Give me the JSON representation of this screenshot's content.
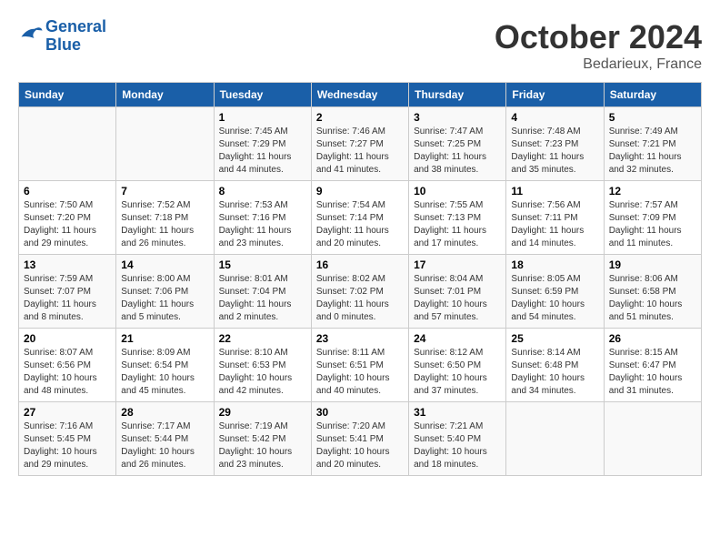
{
  "header": {
    "logo_line1": "General",
    "logo_line2": "Blue",
    "month": "October 2024",
    "location": "Bedarieux, France"
  },
  "days_of_week": [
    "Sunday",
    "Monday",
    "Tuesday",
    "Wednesday",
    "Thursday",
    "Friday",
    "Saturday"
  ],
  "weeks": [
    [
      {
        "day": null
      },
      {
        "day": null
      },
      {
        "day": "1",
        "sunrise": "Sunrise: 7:45 AM",
        "sunset": "Sunset: 7:29 PM",
        "daylight": "Daylight: 11 hours and 44 minutes."
      },
      {
        "day": "2",
        "sunrise": "Sunrise: 7:46 AM",
        "sunset": "Sunset: 7:27 PM",
        "daylight": "Daylight: 11 hours and 41 minutes."
      },
      {
        "day": "3",
        "sunrise": "Sunrise: 7:47 AM",
        "sunset": "Sunset: 7:25 PM",
        "daylight": "Daylight: 11 hours and 38 minutes."
      },
      {
        "day": "4",
        "sunrise": "Sunrise: 7:48 AM",
        "sunset": "Sunset: 7:23 PM",
        "daylight": "Daylight: 11 hours and 35 minutes."
      },
      {
        "day": "5",
        "sunrise": "Sunrise: 7:49 AM",
        "sunset": "Sunset: 7:21 PM",
        "daylight": "Daylight: 11 hours and 32 minutes."
      }
    ],
    [
      {
        "day": "6",
        "sunrise": "Sunrise: 7:50 AM",
        "sunset": "Sunset: 7:20 PM",
        "daylight": "Daylight: 11 hours and 29 minutes."
      },
      {
        "day": "7",
        "sunrise": "Sunrise: 7:52 AM",
        "sunset": "Sunset: 7:18 PM",
        "daylight": "Daylight: 11 hours and 26 minutes."
      },
      {
        "day": "8",
        "sunrise": "Sunrise: 7:53 AM",
        "sunset": "Sunset: 7:16 PM",
        "daylight": "Daylight: 11 hours and 23 minutes."
      },
      {
        "day": "9",
        "sunrise": "Sunrise: 7:54 AM",
        "sunset": "Sunset: 7:14 PM",
        "daylight": "Daylight: 11 hours and 20 minutes."
      },
      {
        "day": "10",
        "sunrise": "Sunrise: 7:55 AM",
        "sunset": "Sunset: 7:13 PM",
        "daylight": "Daylight: 11 hours and 17 minutes."
      },
      {
        "day": "11",
        "sunrise": "Sunrise: 7:56 AM",
        "sunset": "Sunset: 7:11 PM",
        "daylight": "Daylight: 11 hours and 14 minutes."
      },
      {
        "day": "12",
        "sunrise": "Sunrise: 7:57 AM",
        "sunset": "Sunset: 7:09 PM",
        "daylight": "Daylight: 11 hours and 11 minutes."
      }
    ],
    [
      {
        "day": "13",
        "sunrise": "Sunrise: 7:59 AM",
        "sunset": "Sunset: 7:07 PM",
        "daylight": "Daylight: 11 hours and 8 minutes."
      },
      {
        "day": "14",
        "sunrise": "Sunrise: 8:00 AM",
        "sunset": "Sunset: 7:06 PM",
        "daylight": "Daylight: 11 hours and 5 minutes."
      },
      {
        "day": "15",
        "sunrise": "Sunrise: 8:01 AM",
        "sunset": "Sunset: 7:04 PM",
        "daylight": "Daylight: 11 hours and 2 minutes."
      },
      {
        "day": "16",
        "sunrise": "Sunrise: 8:02 AM",
        "sunset": "Sunset: 7:02 PM",
        "daylight": "Daylight: 11 hours and 0 minutes."
      },
      {
        "day": "17",
        "sunrise": "Sunrise: 8:04 AM",
        "sunset": "Sunset: 7:01 PM",
        "daylight": "Daylight: 10 hours and 57 minutes."
      },
      {
        "day": "18",
        "sunrise": "Sunrise: 8:05 AM",
        "sunset": "Sunset: 6:59 PM",
        "daylight": "Daylight: 10 hours and 54 minutes."
      },
      {
        "day": "19",
        "sunrise": "Sunrise: 8:06 AM",
        "sunset": "Sunset: 6:58 PM",
        "daylight": "Daylight: 10 hours and 51 minutes."
      }
    ],
    [
      {
        "day": "20",
        "sunrise": "Sunrise: 8:07 AM",
        "sunset": "Sunset: 6:56 PM",
        "daylight": "Daylight: 10 hours and 48 minutes."
      },
      {
        "day": "21",
        "sunrise": "Sunrise: 8:09 AM",
        "sunset": "Sunset: 6:54 PM",
        "daylight": "Daylight: 10 hours and 45 minutes."
      },
      {
        "day": "22",
        "sunrise": "Sunrise: 8:10 AM",
        "sunset": "Sunset: 6:53 PM",
        "daylight": "Daylight: 10 hours and 42 minutes."
      },
      {
        "day": "23",
        "sunrise": "Sunrise: 8:11 AM",
        "sunset": "Sunset: 6:51 PM",
        "daylight": "Daylight: 10 hours and 40 minutes."
      },
      {
        "day": "24",
        "sunrise": "Sunrise: 8:12 AM",
        "sunset": "Sunset: 6:50 PM",
        "daylight": "Daylight: 10 hours and 37 minutes."
      },
      {
        "day": "25",
        "sunrise": "Sunrise: 8:14 AM",
        "sunset": "Sunset: 6:48 PM",
        "daylight": "Daylight: 10 hours and 34 minutes."
      },
      {
        "day": "26",
        "sunrise": "Sunrise: 8:15 AM",
        "sunset": "Sunset: 6:47 PM",
        "daylight": "Daylight: 10 hours and 31 minutes."
      }
    ],
    [
      {
        "day": "27",
        "sunrise": "Sunrise: 7:16 AM",
        "sunset": "Sunset: 5:45 PM",
        "daylight": "Daylight: 10 hours and 29 minutes."
      },
      {
        "day": "28",
        "sunrise": "Sunrise: 7:17 AM",
        "sunset": "Sunset: 5:44 PM",
        "daylight": "Daylight: 10 hours and 26 minutes."
      },
      {
        "day": "29",
        "sunrise": "Sunrise: 7:19 AM",
        "sunset": "Sunset: 5:42 PM",
        "daylight": "Daylight: 10 hours and 23 minutes."
      },
      {
        "day": "30",
        "sunrise": "Sunrise: 7:20 AM",
        "sunset": "Sunset: 5:41 PM",
        "daylight": "Daylight: 10 hours and 20 minutes."
      },
      {
        "day": "31",
        "sunrise": "Sunrise: 7:21 AM",
        "sunset": "Sunset: 5:40 PM",
        "daylight": "Daylight: 10 hours and 18 minutes."
      },
      {
        "day": null
      },
      {
        "day": null
      }
    ]
  ]
}
